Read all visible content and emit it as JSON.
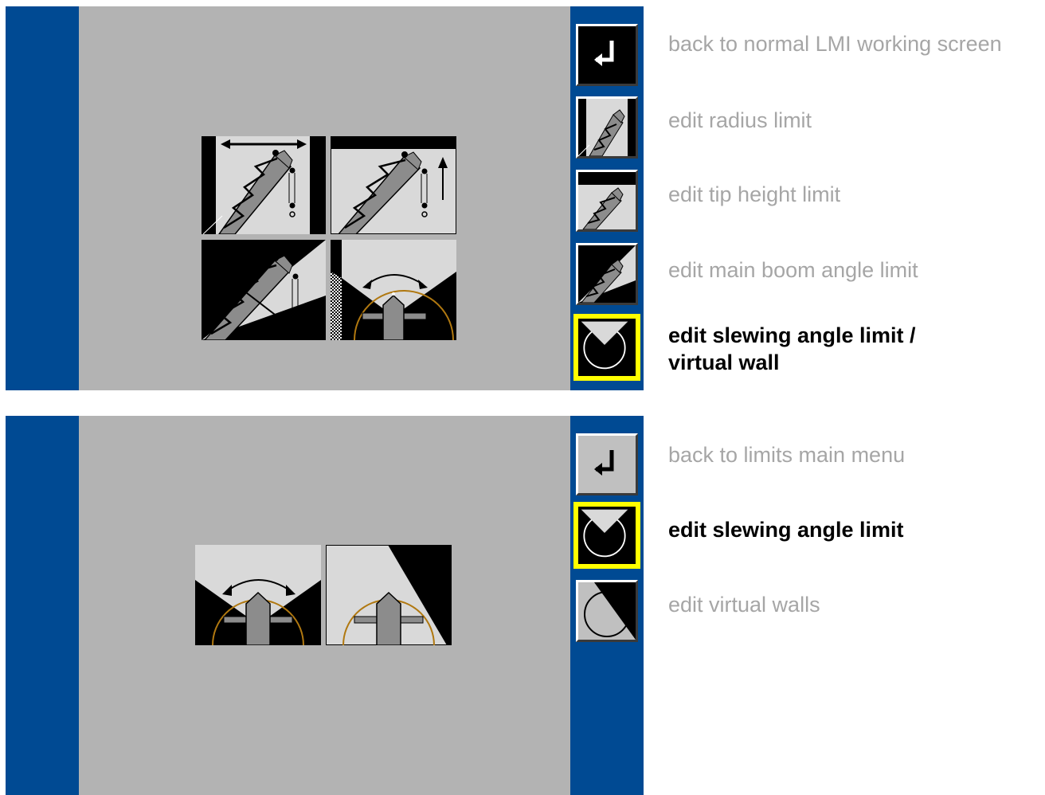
{
  "screen_limits_main": {
    "softkeys": [
      {
        "name": "back-softkey",
        "icon": "return-arrow-icon"
      },
      {
        "name": "radius-limit-softkey",
        "icon": "radius-limit-icon"
      },
      {
        "name": "tip-height-limit-softkey",
        "icon": "tip-height-limit-icon"
      },
      {
        "name": "boom-angle-limit-softkey",
        "icon": "boom-angle-limit-icon"
      },
      {
        "name": "slewing-angle-limit-softkey",
        "icon": "slewing-limit-icon",
        "selected": true
      }
    ],
    "labels": {
      "back": "back to normal LMI working screen",
      "radius": "edit radius limit",
      "tip_height": "edit tip height limit",
      "boom_angle": "edit main boom angle limit",
      "slewing_line1": "edit slewing angle limit /",
      "slewing_line2": "virtual wall"
    }
  },
  "screen_slewing_menu": {
    "softkeys": [
      {
        "name": "back-softkey",
        "icon": "return-arrow-icon"
      },
      {
        "name": "slewing-angle-softkey",
        "icon": "slewing-limit-icon",
        "selected": true
      },
      {
        "name": "virtual-walls-softkey",
        "icon": "virtual-wall-icon"
      }
    ],
    "labels": {
      "back": "back to limits main menu",
      "slewing": "edit slewing angle limit",
      "walls": "edit virtual walls"
    }
  },
  "colors": {
    "screen_bg": "#b3b3b3",
    "side_bar": "#004a93",
    "selection": "#ffff00",
    "inactive_text": "#a6a6a6",
    "active_text": "#000000"
  }
}
